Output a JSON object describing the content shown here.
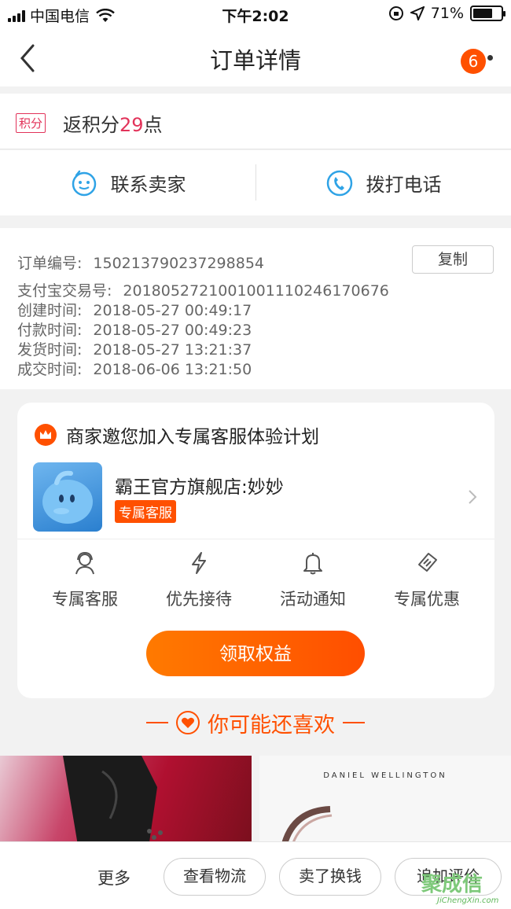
{
  "status_bar": {
    "carrier": "中国电信",
    "time": "下午2:02",
    "battery_percent": "71%",
    "battery_level": 0.71
  },
  "nav": {
    "title": "订单详情",
    "badge_count": "6"
  },
  "points": {
    "tag": "积分",
    "prefix": "返积分",
    "value": "29",
    "suffix": "点"
  },
  "contact": {
    "seller_label": "联系卖家",
    "phone_label": "拨打电话"
  },
  "order_info": {
    "copy_button": "复制",
    "rows": [
      {
        "label": "订单编号:",
        "value": "150213790237298854"
      },
      {
        "label": "支付宝交易号:",
        "value": "2018052721001001110246170676"
      },
      {
        "label": "创建时间:",
        "value": "2018-05-27 00:49:17"
      },
      {
        "label": "付款时间:",
        "value": "2018-05-27 00:49:23"
      },
      {
        "label": "发货时间:",
        "value": "2018-05-27 13:21:37"
      },
      {
        "label": "成交时间:",
        "value": "2018-06-06 13:21:50"
      }
    ]
  },
  "service_card": {
    "title": "商家邀您加入专属客服体验计划",
    "shop_name": "霸王官方旗舰店:妙妙",
    "shop_tag": "专属客服",
    "perks": [
      {
        "label": "专属客服",
        "icon": "service-person-icon"
      },
      {
        "label": "优先接待",
        "icon": "lightning-icon"
      },
      {
        "label": "活动通知",
        "icon": "bell-icon"
      },
      {
        "label": "专属优惠",
        "icon": "ticket-icon"
      }
    ],
    "cta": "领取权益"
  },
  "recommend": {
    "title": "你可能还喜欢",
    "product2_brand": "DANIEL WELLINGTON"
  },
  "bottom_bar": {
    "more": "更多",
    "buttons": [
      "查看物流",
      "卖了换钱",
      "追加评价"
    ]
  },
  "watermark": {
    "text": "聚成信",
    "url": "JiChengXin.com"
  },
  "colors": {
    "accent": "#ff5000",
    "points_red": "#e2335a",
    "contact_blue": "#2fa3e6"
  }
}
